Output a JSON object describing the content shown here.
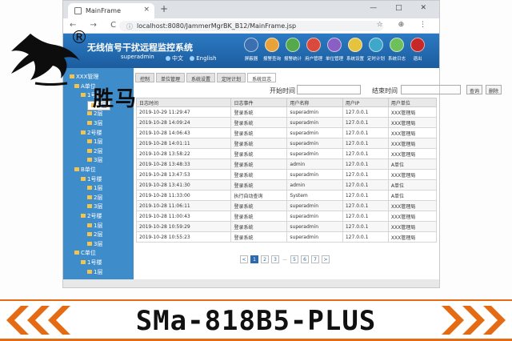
{
  "browser": {
    "tab_title": "MainFrame",
    "tab_close": "×",
    "new_tab": "+",
    "window_controls": "— □ ✕",
    "nav_buttons": "← → C",
    "lock_icon": "ⓘ",
    "url": "localhost:8080/JammerMgrBK_B12/MainFrame.jsp",
    "addr_icons": "☆ ⊕ ⋮"
  },
  "app": {
    "title": "无线信号干扰远程监控系统",
    "user": "superadmin",
    "lang_cn": "中文",
    "lang_en": "English",
    "tools": [
      {
        "label": "屏蔽器",
        "color": "#3a6fb0"
      },
      {
        "label": "报警查询",
        "color": "#e8a23a"
      },
      {
        "label": "报警统计",
        "color": "#55a94a"
      },
      {
        "label": "用户管理",
        "color": "#d94a3a"
      },
      {
        "label": "单位管理",
        "color": "#8a5fc4"
      },
      {
        "label": "系统设置",
        "color": "#e6c33f"
      },
      {
        "label": "定时计划",
        "color": "#3fa7c9"
      },
      {
        "label": "系统日志",
        "color": "#6fbf5a"
      },
      {
        "label": "退出",
        "color": "#c62828"
      }
    ]
  },
  "tabs": [
    {
      "label": "控制",
      "active": false
    },
    {
      "label": "单位管理",
      "active": false
    },
    {
      "label": "系统设置",
      "active": false
    },
    {
      "label": "定时计划",
      "active": false
    },
    {
      "label": "系统日志",
      "active": true
    }
  ],
  "search": {
    "start_label": "开始时间",
    "end_label": "结束时间",
    "query_button": "查询",
    "delete_button": "删除"
  },
  "tree": [
    {
      "label": "XXX管理",
      "level": 0
    },
    {
      "label": "A单位",
      "level": 1
    },
    {
      "label": "1号楼",
      "level": 2
    },
    {
      "label": "1层",
      "level": 3,
      "selected": true
    },
    {
      "label": "2层",
      "level": 3
    },
    {
      "label": "3层",
      "level": 3
    },
    {
      "label": "2号楼",
      "level": 2
    },
    {
      "label": "1层",
      "level": 3
    },
    {
      "label": "2层",
      "level": 3
    },
    {
      "label": "3层",
      "level": 3
    },
    {
      "label": "B单位",
      "level": 1
    },
    {
      "label": "1号楼",
      "level": 2
    },
    {
      "label": "1层",
      "level": 3
    },
    {
      "label": "2层",
      "level": 3
    },
    {
      "label": "3层",
      "level": 3
    },
    {
      "label": "2号楼",
      "level": 2
    },
    {
      "label": "1层",
      "level": 3
    },
    {
      "label": "2层",
      "level": 3
    },
    {
      "label": "3层",
      "level": 3
    },
    {
      "label": "C单位",
      "level": 1
    },
    {
      "label": "1号楼",
      "level": 2
    },
    {
      "label": "1层",
      "level": 3
    }
  ],
  "table": {
    "columns": [
      "日志时间",
      "日志事件",
      "用户名称",
      "用户IP",
      "用户单位"
    ],
    "rows": [
      [
        "2019-10-29 11:29:47",
        "登录系统",
        "superadmin",
        "127.0.0.1",
        "XXX管理局"
      ],
      [
        "2019-10-28 14:09:24",
        "登录系统",
        "superadmin",
        "127.0.0.1",
        "XXX管理局"
      ],
      [
        "2019-10-28 14:06:43",
        "登录系统",
        "superadmin",
        "127.0.0.1",
        "XXX管理局"
      ],
      [
        "2019-10-28 14:01:11",
        "登录系统",
        "superadmin",
        "127.0.0.1",
        "XXX管理局"
      ],
      [
        "2019-10-28 13:58:22",
        "登录系统",
        "superadmin",
        "127.0.0.1",
        "XXX管理局"
      ],
      [
        "2019-10-28 13:48:33",
        "登录系统",
        "admin",
        "127.0.0.1",
        "A单位"
      ],
      [
        "2019-10-28 13:47:53",
        "登录系统",
        "superadmin",
        "127.0.0.1",
        "XXX管理局"
      ],
      [
        "2019-10-28 13:41:30",
        "登录系统",
        "admin",
        "127.0.0.1",
        "A单位"
      ],
      [
        "2019-10-28 11:33:00",
        "执行自动查询",
        "System",
        "127.0.0.1",
        "A单位"
      ],
      [
        "2019-10-28 11:06:11",
        "登录系统",
        "superadmin",
        "127.0.0.1",
        "XXX管理局"
      ],
      [
        "2019-10-28 11:00:43",
        "登录系统",
        "superadmin",
        "127.0.0.1",
        "XXX管理局"
      ],
      [
        "2019-10-28 10:59:29",
        "登录系统",
        "superadmin",
        "127.0.0.1",
        "XXX管理局"
      ],
      [
        "2019-10-28 10:55:23",
        "登录系统",
        "superadmin",
        "127.0.0.1",
        "XXX管理局"
      ]
    ]
  },
  "pager": {
    "items": [
      "<",
      "1",
      "2",
      "3",
      "...",
      "5",
      "6",
      "7",
      ">"
    ],
    "current": "1"
  },
  "logo": {
    "reg": "®",
    "text": "胜马"
  },
  "footer": {
    "model": "SMa-818B5-PLUS",
    "accent": "#e56a14"
  }
}
